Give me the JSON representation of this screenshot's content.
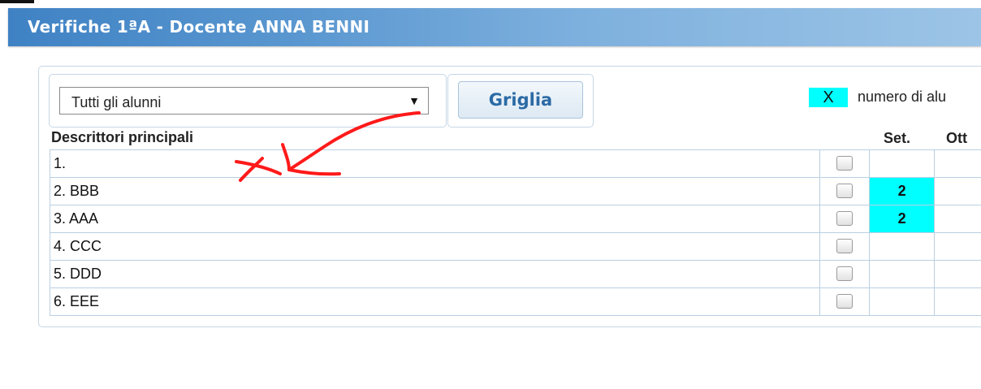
{
  "header": {
    "title": "Verifiche 1ªA - Docente ANNA BENNI"
  },
  "filter": {
    "selected": "Tutti gli alunni"
  },
  "grid_button": {
    "label": "Griglia"
  },
  "legend": {
    "swatch_text": "X",
    "text": "numero di alu"
  },
  "table": {
    "header_label": "Descrittori principali",
    "header_set": "Set.",
    "header_ott": "Ott",
    "rows": [
      {
        "label": "1.",
        "set": ""
      },
      {
        "label": "2. BBB",
        "set": "2"
      },
      {
        "label": "3. AAA",
        "set": "2"
      },
      {
        "label": "4. CCC",
        "set": ""
      },
      {
        "label": "5. DDD",
        "set": ""
      },
      {
        "label": "6. EEE",
        "set": ""
      }
    ]
  },
  "colors": {
    "header": "#4a89c8",
    "highlight": "#00ffff",
    "annotation": "#ff0000"
  }
}
